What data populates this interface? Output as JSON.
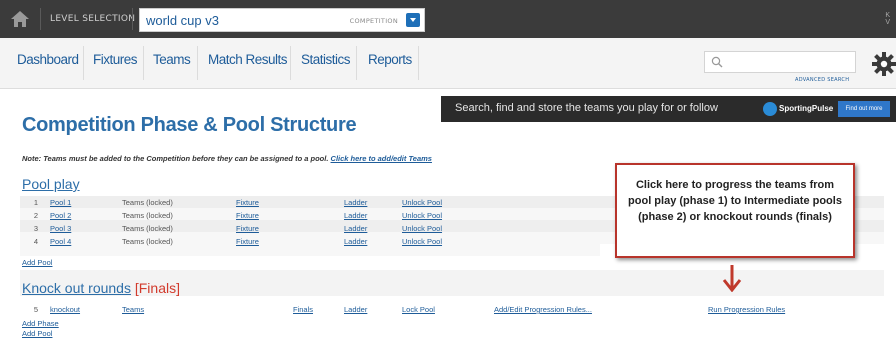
{
  "topbar": {
    "level_label": "LEVEL SELECTION",
    "competition_name": "world cup v3",
    "competition_type": "COMPETITION",
    "right_text_1": "K",
    "right_text_2": "V"
  },
  "nav": {
    "items": [
      "Dashboard",
      "Fixtures",
      "Teams",
      "Match Results",
      "Statistics",
      "Reports"
    ],
    "search_placeholder": "",
    "advanced_search": "ADVANCED SEARCH"
  },
  "banner": {
    "text": "Search, find and store the teams you play for or follow",
    "brand": "SportingPulse",
    "button": "Find out more"
  },
  "page": {
    "title": "Competition Phase & Pool Structure",
    "note_text": "Note: Teams must be added to the Competition before they can be assigned to a pool.",
    "note_link": "Click here to add/edit Teams"
  },
  "pool_play": {
    "title": "Pool play",
    "rows": [
      {
        "num": "1",
        "pool": "Pool 1",
        "teams": "Teams (locked)",
        "fixture": "Fixture",
        "ladder": "Ladder",
        "action": "Unlock Pool"
      },
      {
        "num": "2",
        "pool": "Pool 2",
        "teams": "Teams (locked)",
        "fixture": "Fixture",
        "ladder": "Ladder",
        "action": "Unlock Pool"
      },
      {
        "num": "3",
        "pool": "Pool 3",
        "teams": "Teams (locked)",
        "fixture": "Fixture",
        "ladder": "Ladder",
        "action": "Unlock Pool"
      },
      {
        "num": "4",
        "pool": "Pool 4",
        "teams": "Teams (locked)",
        "fixture": "Fixture",
        "ladder": "Ladder",
        "action": "Unlock Pool"
      }
    ],
    "add_pool": "Add Pool"
  },
  "knockout": {
    "title": "Knock out rounds",
    "finals_label": "[Finals]",
    "row": {
      "num": "5",
      "pool": "knockout",
      "teams": "Teams",
      "finals": "Finals",
      "ladder": "Ladder",
      "lock": "Lock Pool",
      "edit_rules": "Add/Edit Progression Rules...",
      "run_rules": "Run Progression Rules"
    },
    "add_phase": "Add Phase",
    "add_pool": "Add Pool"
  },
  "callout": {
    "text": "Click here to progress the teams from pool play (phase 1) to Intermediate pools (phase 2) or knockout rounds (finals)",
    "border_color": "#b8342b",
    "arrow_color": "#c0392b"
  }
}
